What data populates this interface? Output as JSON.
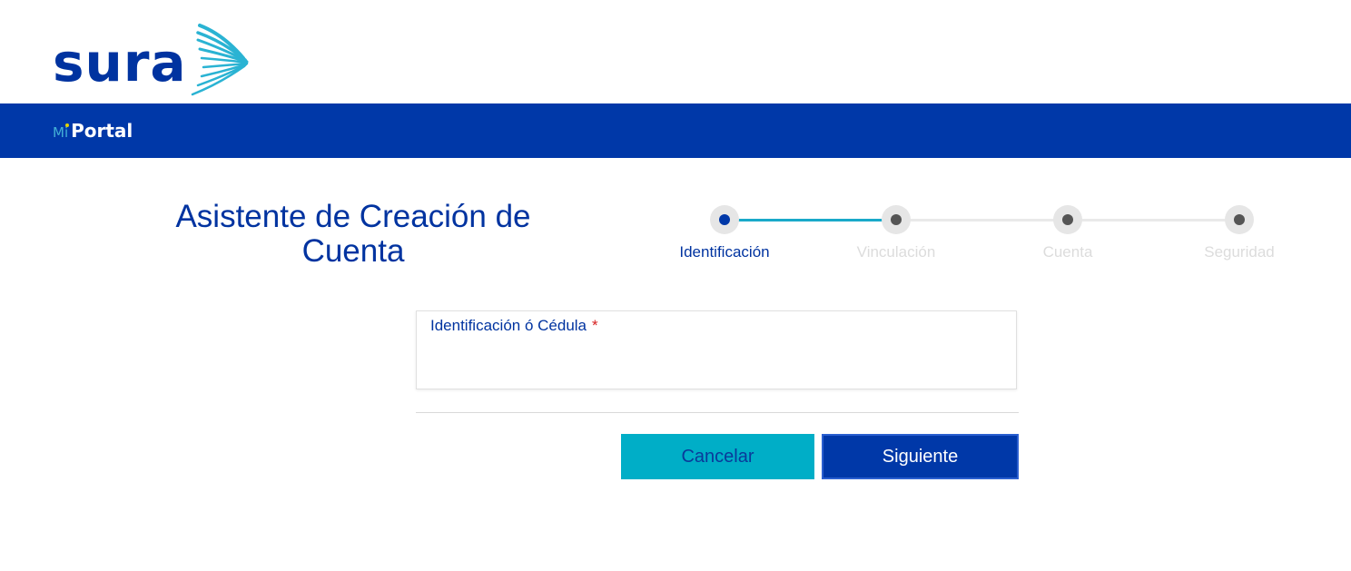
{
  "header": {
    "logo_text": "sura",
    "portal_prefix": "Mi",
    "portal_name": "Portal"
  },
  "wizard": {
    "title": "Asistente de Creación de Cuenta",
    "steps": [
      {
        "label": "Identificación",
        "status": "active"
      },
      {
        "label": "Vinculación",
        "status": "pending"
      },
      {
        "label": "Cuenta",
        "status": "pending"
      },
      {
        "label": "Seguridad",
        "status": "pending"
      }
    ]
  },
  "form": {
    "id_field": {
      "label": "Identificación ó Cédula",
      "required_mark": "*",
      "value": ""
    }
  },
  "actions": {
    "cancel_label": "Cancelar",
    "next_label": "Siguiente"
  },
  "colors": {
    "brand_blue": "#0038a8",
    "accent_cyan": "#00aec7",
    "required_red": "#d62020"
  }
}
